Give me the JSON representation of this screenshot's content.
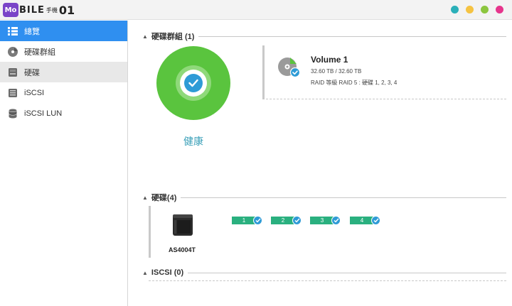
{
  "logo": {
    "badge": "Mo",
    "word": "BILE",
    "small": "手機",
    "num": "01"
  },
  "window_controls": [
    {
      "name": "teal",
      "color": "#2bb0b9"
    },
    {
      "name": "yellow",
      "color": "#f5c342"
    },
    {
      "name": "green",
      "color": "#8cc63f"
    },
    {
      "name": "magenta",
      "color": "#e6358c"
    }
  ],
  "sidebar": {
    "items": [
      {
        "label": "總覽",
        "icon": "list-icon",
        "state": "active"
      },
      {
        "label": "硬碟群組",
        "icon": "disk-group-icon",
        "state": "normal"
      },
      {
        "label": "硬碟",
        "icon": "drive-icon",
        "state": "hover"
      },
      {
        "label": "iSCSI",
        "icon": "iscsi-icon",
        "state": "normal"
      },
      {
        "label": "iSCSI LUN",
        "icon": "database-icon",
        "state": "normal"
      }
    ]
  },
  "main": {
    "volume_section": {
      "title": "硬碟群組 (1)",
      "health": {
        "label": "健康",
        "color": "#5ac43e"
      },
      "volume": {
        "name": "Volume 1",
        "size": "32.60 TB / 32.60 TB",
        "raid": "RAID 等級 RAID 5 : 硬碟 1, 2, 3, 4"
      }
    },
    "disk_section": {
      "title": "硬碟(4)",
      "device": {
        "name": "AS4004T"
      },
      "drives": [
        "1",
        "2",
        "3",
        "4"
      ],
      "drive_color": "#2ab07f"
    },
    "iscsi_section": {
      "title": "ISCSI (0)"
    }
  },
  "colors": {
    "accent": "#2f8ff0",
    "check": "#2e9bd6"
  }
}
